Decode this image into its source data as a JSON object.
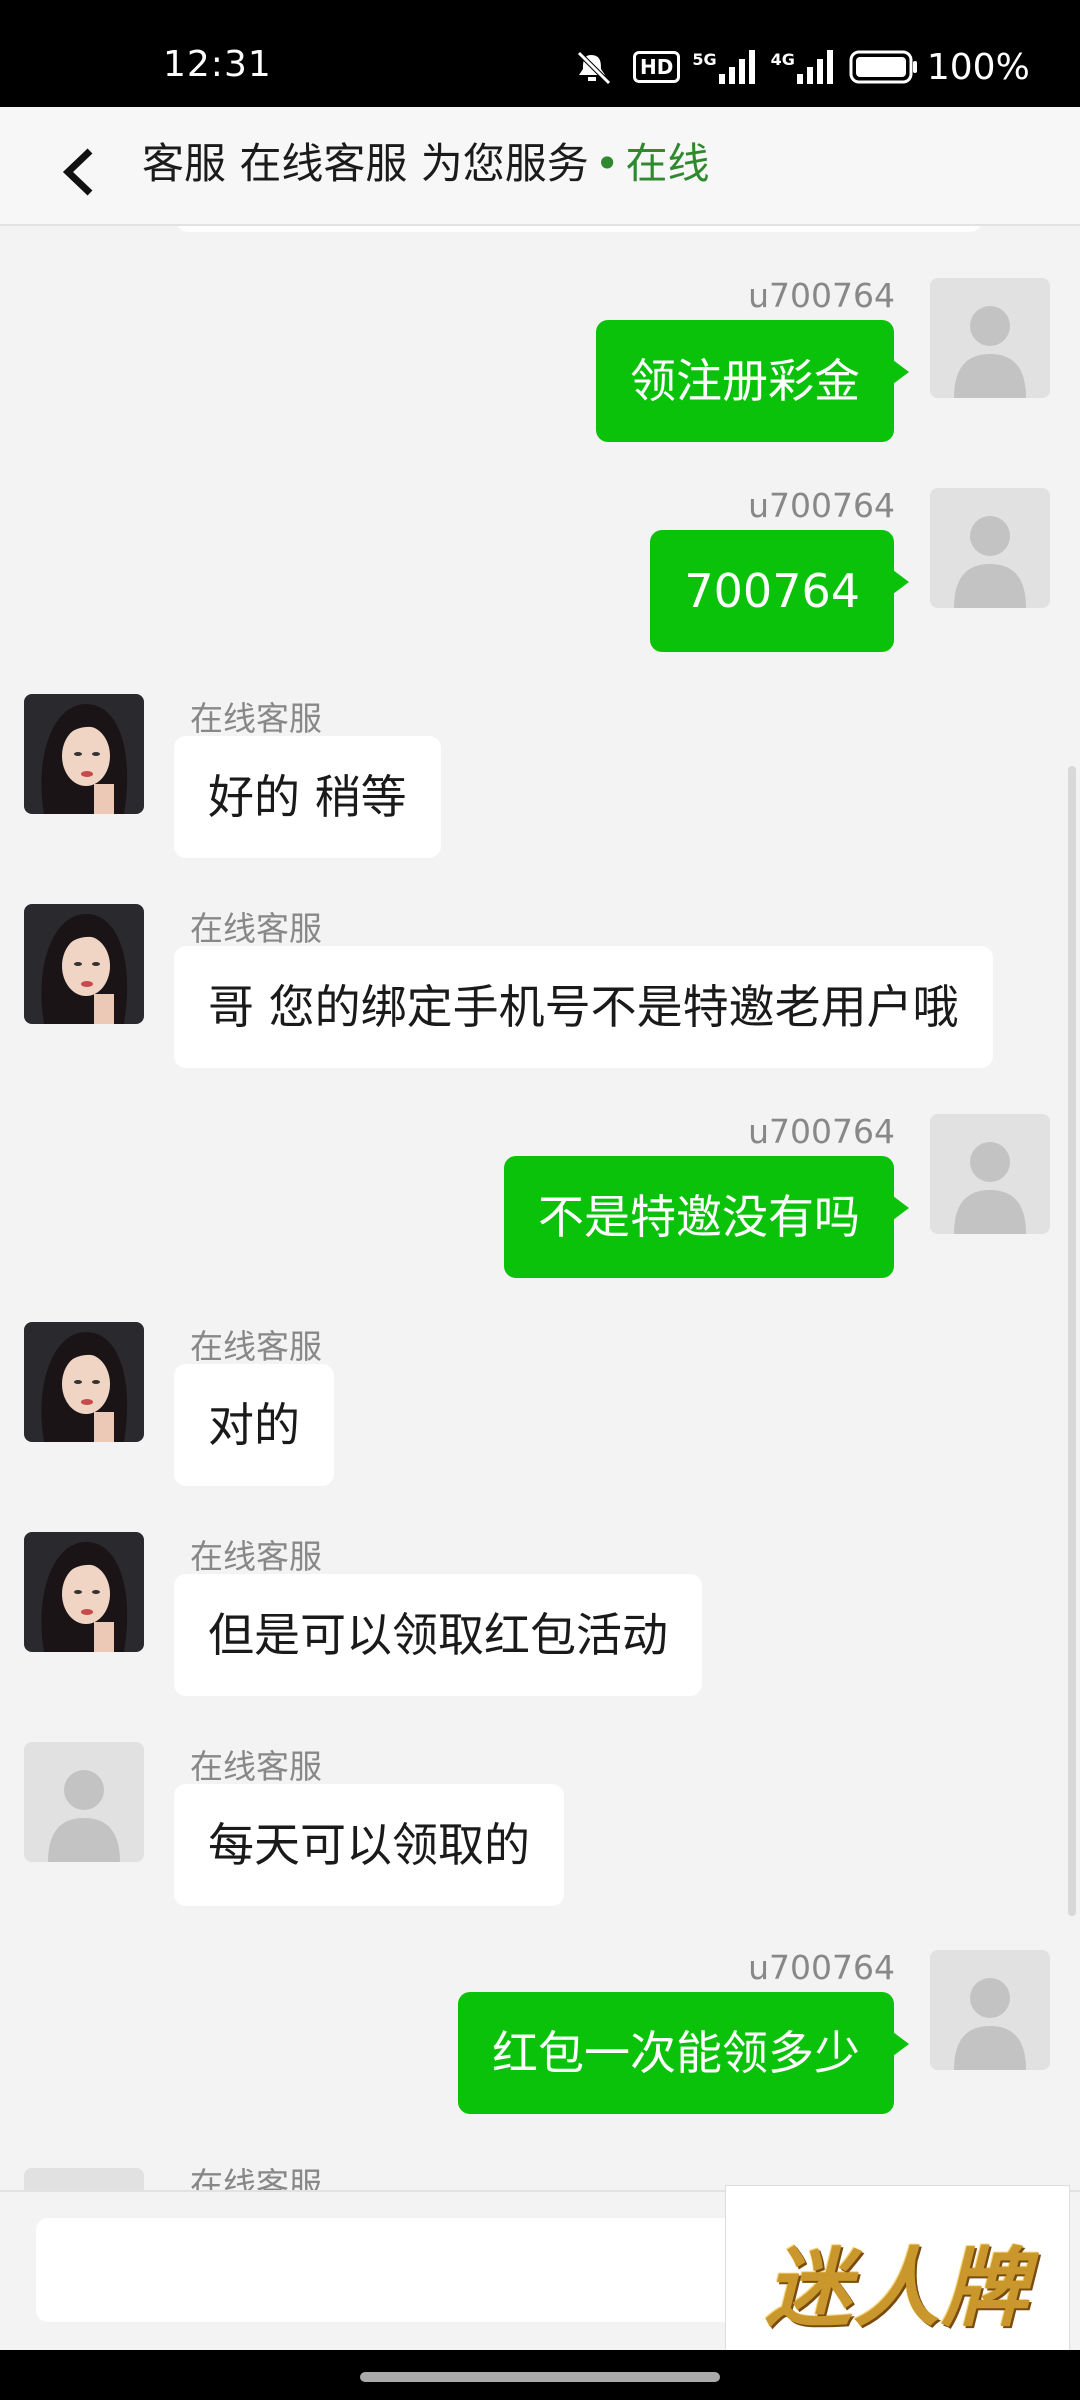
{
  "status_bar": {
    "time": "12:31",
    "network_5g": "5G",
    "network_4g": "4G",
    "hd_badge": "HD",
    "battery": "100%"
  },
  "header": {
    "title": "客服 在线客服 为您服务",
    "dot": "•",
    "status": "在线"
  },
  "messages": [
    {
      "side": "right",
      "sender": "u700764",
      "text": "领注册彩金"
    },
    {
      "side": "right",
      "sender": "u700764",
      "text": "700764"
    },
    {
      "side": "left",
      "sender": "在线客服",
      "text": "好的 稍等"
    },
    {
      "side": "left",
      "sender": "在线客服",
      "text": "哥 您的绑定手机号不是特邀老用户哦"
    },
    {
      "side": "right",
      "sender": "u700764",
      "text": "不是特邀没有吗"
    },
    {
      "side": "left",
      "sender": "在线客服",
      "text": "对的"
    },
    {
      "side": "left",
      "sender": "在线客服",
      "text": "但是可以领取红包活动"
    },
    {
      "side": "left",
      "sender": "在线客服",
      "text": "每天可以领取的"
    },
    {
      "side": "right",
      "sender": "u700764",
      "text": "红包一次能领多少"
    },
    {
      "side": "left",
      "sender": "在线客服",
      "text": ""
    }
  ],
  "input": {
    "value": "",
    "placeholder": ""
  },
  "watermark": {
    "text": "迷人牌"
  },
  "colors": {
    "sent_bubble": "#0ac20a",
    "received_bubble": "#ffffff",
    "background": "#f3f3f3",
    "online_green": "#2f8a2f"
  }
}
